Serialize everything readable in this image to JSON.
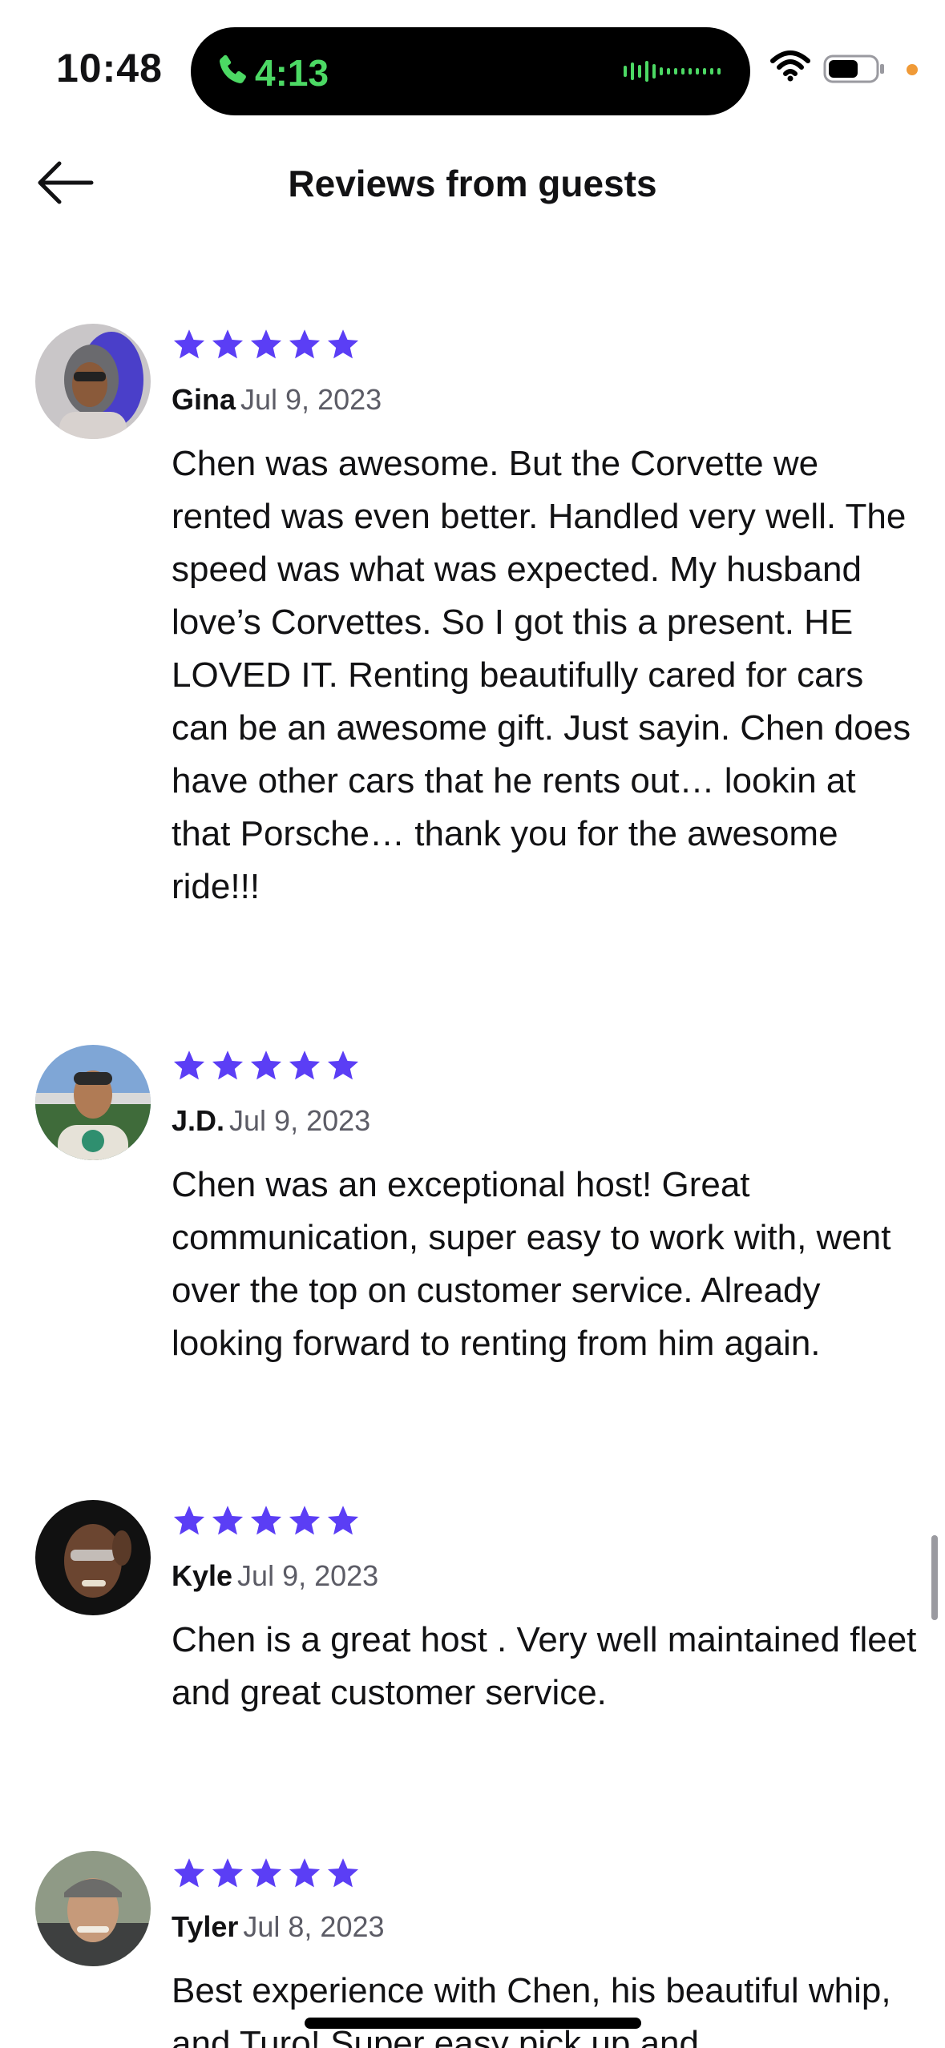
{
  "status_bar": {
    "time": "10:48",
    "call_timer": "4:13",
    "icons": [
      "phone-icon",
      "waveform-icon",
      "wifi-icon",
      "battery-icon"
    ],
    "call_color": "#4cd964",
    "indicator_color": "#f09a37"
  },
  "header": {
    "title": "Reviews from guests",
    "back_icon": "arrow-left-icon"
  },
  "accent_color": "#5b3ef5",
  "reviews": [
    {
      "name": "Gina",
      "date": "Jul 9, 2023",
      "rating": 5,
      "text": "Chen was awesome. But the Corvette we rented was even better. Handled very well. The speed was what was expected. My husband love’s Corvettes. So I got this a present. HE LOVED IT. Renting beautifully cared for cars can be an awesome gift. Just sayin. Chen does have other cars that he rents out… lookin at that Porsche… thank you for the awesome ride!!!"
    },
    {
      "name": "J.D.",
      "date": "Jul 9, 2023",
      "rating": 5,
      "text": "Chen was an exceptional host! Great communication, super easy to work with, went over the top on customer service. Already looking forward to renting from him again."
    },
    {
      "name": "Kyle",
      "date": "Jul 9, 2023",
      "rating": 5,
      "text": "Chen is a great host . Very well maintained fleet and great customer service."
    },
    {
      "name": "Tyler",
      "date": "Jul 8, 2023",
      "rating": 5,
      "text": "Best experience with Chen, his beautiful whip, and Turo! Super easy pick up and"
    }
  ]
}
